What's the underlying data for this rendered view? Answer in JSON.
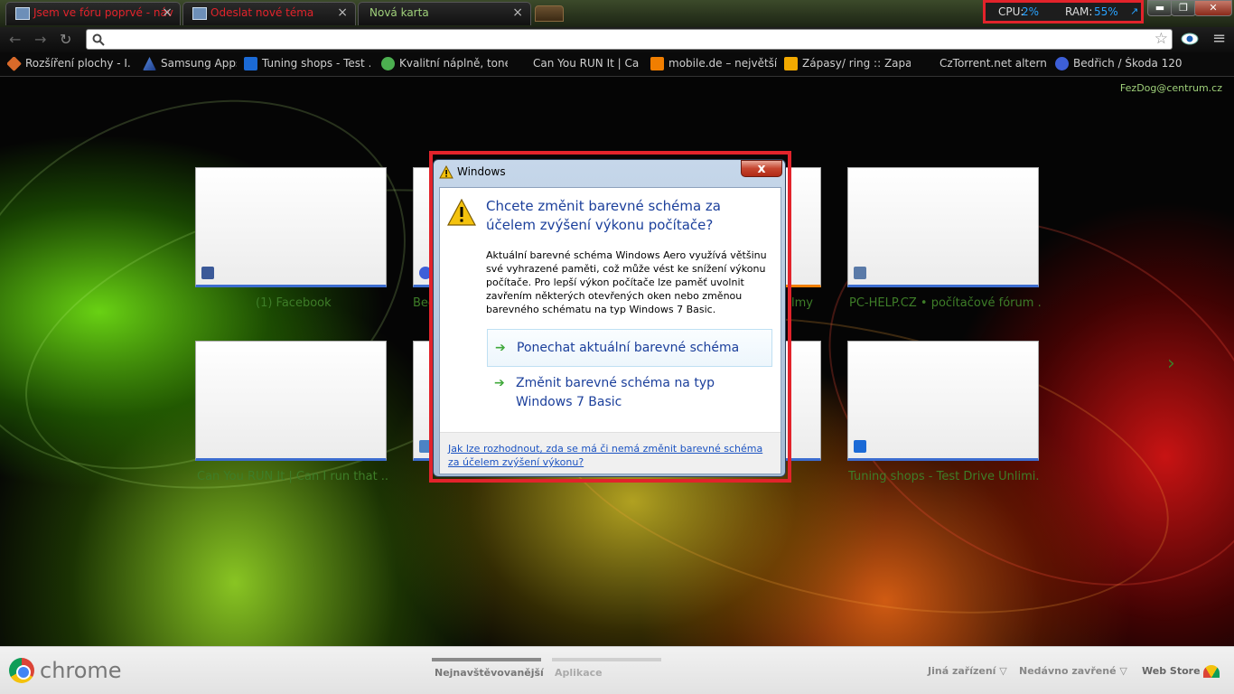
{
  "tabs": [
    {
      "title": "Jsem ve fóru poprvé - náv",
      "close": "×"
    },
    {
      "title": "Odeslat nové téma",
      "close": "×"
    },
    {
      "title": "Nová karta",
      "close": "×"
    }
  ],
  "system_monitor": {
    "cpu_label": "CPU:",
    "cpu_value": "2%",
    "ram_label": "RAM:",
    "ram_value": "55%",
    "arrow": "↗"
  },
  "window_controls": {
    "minimize": "▬",
    "maximize": "❐",
    "close": "✕"
  },
  "toolbar": {
    "back": "←",
    "forward": "→",
    "reload": "↻",
    "star": "☆",
    "menu": "≡",
    "omnibox_placeholder": ""
  },
  "bookmarks": [
    {
      "label": "Rozšíření plochy - I...",
      "color": "#d96a2a"
    },
    {
      "label": "Samsung Apps",
      "color": "#2b5fb8"
    },
    {
      "label": "Tuning shops - Test ...",
      "color": "#1b6ad6"
    },
    {
      "label": "Kvalitní náplně, tone...",
      "color": "#4caf50"
    },
    {
      "label": "Can You RUN It | Ca...",
      "color": ""
    },
    {
      "label": "mobile.de – největší ...",
      "color": "#f07e00"
    },
    {
      "label": "Zápasy/ ring :: Zapa...",
      "color": "#f2a900"
    },
    {
      "label": "CzTorrent.net altern...",
      "color": ""
    },
    {
      "label": "Bedřich / Škoda 120 ...",
      "color": "#3d5fd8"
    }
  ],
  "user_email": "FezDog@centrum.cz",
  "tiles": [
    {
      "label": "(1) Facebook",
      "icon_color": "#3b5998"
    },
    {
      "label": "Bed",
      "icon_color": "#3d5fd8"
    },
    {
      "label": "",
      "icon_color": ""
    },
    {
      "label": "lmy",
      "icon_color": ""
    },
    {
      "label": "PC-HELP.CZ • počítačové fórum ...",
      "icon_color": "#5a7aa8"
    },
    {
      "label": "Can You RUN It | Can I run that ...",
      "icon_color": ""
    },
    {
      "label": "",
      "icon_color": "#4c83c4"
    },
    {
      "label": "",
      "icon_color": ""
    },
    {
      "label": "",
      "icon_color": ""
    },
    {
      "label": "Tuning shops - Test Drive Unlimi...",
      "icon_color": "#1b6ad6"
    }
  ],
  "next_arrow": "›",
  "dialog": {
    "title": "Windows",
    "close": "x",
    "heading": "Chcete změnit barevné schéma za účelem zvýšení výkonu počítače?",
    "body": "Aktuální barevné schéma Windows Aero využívá většinu své vyhrazené paměti, což může vést ke snížení výkonu počítače. Pro lepší výkon počítače lze paměť uvolnit zavřením některých otevřených oken nebo změnou barevného schématu na typ Windows 7 Basic.",
    "option1": "Ponechat aktuální barevné schéma",
    "option2": "Změnit barevné schéma na typ Windows 7 Basic",
    "arrow": "➔",
    "help_link": "Jak lze rozhodnout, zda se má či nemá změnit barevné schéma za účelem zvýšení výkonu?"
  },
  "bottombar": {
    "brand": "chrome",
    "tab_most_visited": "Nejnavštěvovanější",
    "tab_apps": "Aplikace",
    "other_devices": "Jiná zařízení ▽",
    "recently_closed": "Nedávno zavřené ▽",
    "web_store": "Web Store"
  },
  "colors": {
    "highlight": "#e2232b",
    "tab_text_red": "#e2232b",
    "tab_text_green": "#9fd07a",
    "tile_label": "#3e7d28"
  }
}
